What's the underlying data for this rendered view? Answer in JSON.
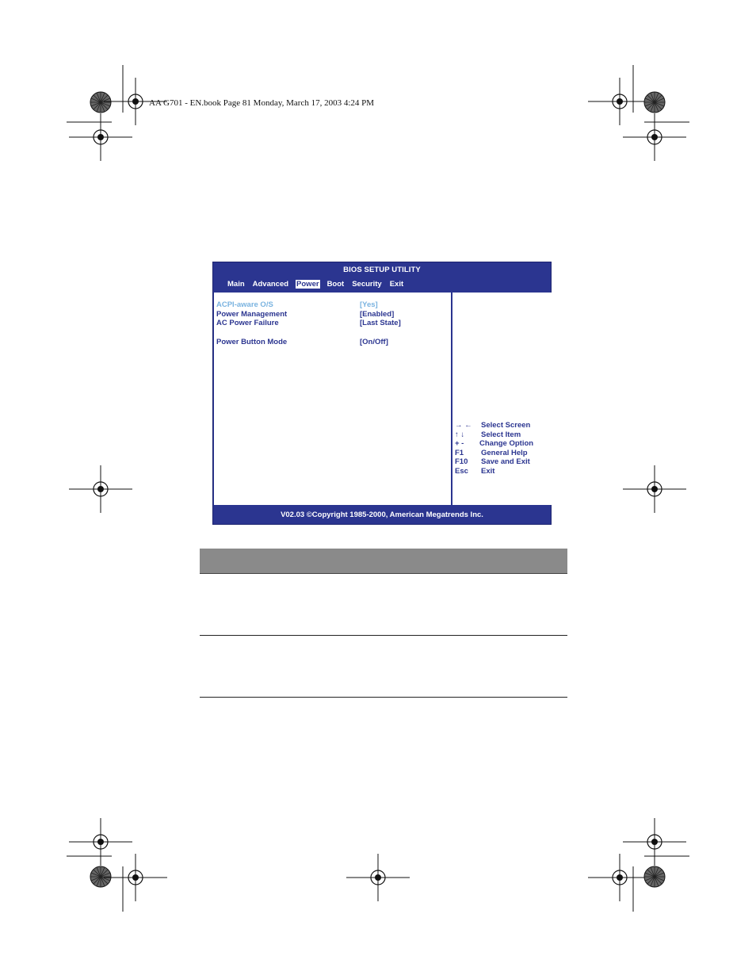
{
  "page_header": "AA G701 - EN.book  Page 81  Monday, March 17, 2003  4:24 PM",
  "bios": {
    "title": "BIOS SETUP UTILITY",
    "menu": [
      {
        "label": "Main",
        "active": false
      },
      {
        "label": "Advanced",
        "active": false
      },
      {
        "label": "Power",
        "active": true
      },
      {
        "label": "Boot",
        "active": false
      },
      {
        "label": "Security",
        "active": false
      },
      {
        "label": "Exit",
        "active": false
      }
    ],
    "options": [
      {
        "label": "ACPI-aware O/S",
        "value": "[Yes]",
        "disabled": true
      },
      {
        "label": "Power Management",
        "value": "[Enabled]",
        "disabled": false
      },
      {
        "label": "AC Power Failure",
        "value": "[Last State]",
        "disabled": false
      },
      {
        "label": "Power Button Mode",
        "value": "[On/Off]",
        "disabled": false
      }
    ],
    "help_keys": [
      {
        "key": "→ ←",
        "desc": "Select Screen"
      },
      {
        "key": "↑ ↓",
        "desc": "Select Item"
      },
      {
        "key": "+ -",
        "desc": "Change Option"
      },
      {
        "key": "F1",
        "desc": "General Help"
      },
      {
        "key": "F10",
        "desc": "Save and Exit"
      },
      {
        "key": "Esc",
        "desc": "Exit"
      }
    ],
    "footer": "V02.03 ©Copyright 1985-2000, American Megatrends Inc.",
    "colors": {
      "frame": "#2b3590",
      "text": "#2b3590",
      "disabled": "#7ab3e0"
    }
  }
}
